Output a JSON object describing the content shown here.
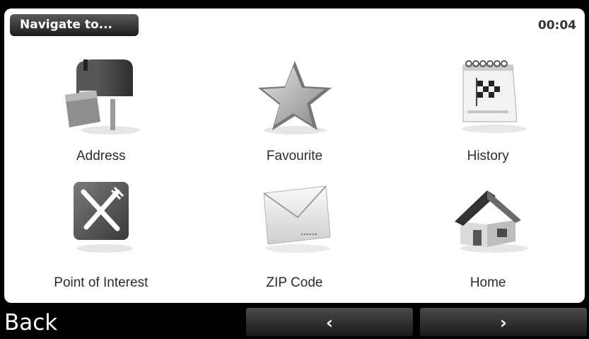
{
  "header": {
    "title": "Navigate to...",
    "time": "00:04"
  },
  "menu": [
    {
      "label": "Address",
      "icon": "mailbox-icon"
    },
    {
      "label": "Favourite",
      "icon": "star-icon"
    },
    {
      "label": "History",
      "icon": "calendar-flag-icon"
    },
    {
      "label": "Point of Interest",
      "icon": "fork-knife-icon"
    },
    {
      "label": "ZIP Code",
      "icon": "envelope-icon"
    },
    {
      "label": "Home",
      "icon": "house-icon"
    }
  ],
  "footer": {
    "back_label": "Back",
    "prev_glyph": "‹",
    "next_glyph": "›"
  }
}
